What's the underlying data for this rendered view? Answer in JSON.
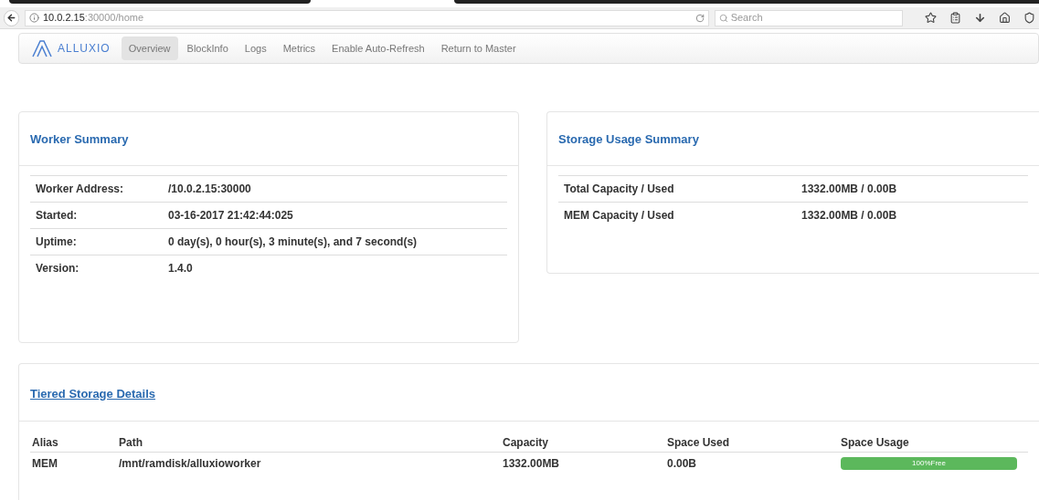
{
  "browser": {
    "url_host": "10.0.2.15",
    "url_rest": ":30000/home",
    "search_placeholder": "Search"
  },
  "navbar": {
    "brand": "ALLUXIO",
    "items": [
      {
        "label": "Overview",
        "selected": true
      },
      {
        "label": "BlockInfo",
        "selected": false
      },
      {
        "label": "Logs",
        "selected": false
      },
      {
        "label": "Metrics",
        "selected": false
      },
      {
        "label": "Enable Auto-Refresh",
        "selected": false
      },
      {
        "label": "Return to Master",
        "selected": false
      }
    ]
  },
  "worker_summary": {
    "title": "Worker Summary",
    "rows": [
      {
        "label": "Worker Address:",
        "value": "/10.0.2.15:30000"
      },
      {
        "label": "Started:",
        "value": "03-16-2017 21:42:44:025"
      },
      {
        "label": "Uptime:",
        "value": "0 day(s), 0 hour(s), 3 minute(s), and 7 second(s)"
      },
      {
        "label": "Version:",
        "value": "1.4.0"
      }
    ]
  },
  "storage_usage_summary": {
    "title": "Storage Usage Summary",
    "rows": [
      {
        "label": "Total Capacity / Used",
        "value": "1332.00MB / 0.00B"
      },
      {
        "label": "MEM Capacity / Used",
        "value": "1332.00MB / 0.00B"
      }
    ]
  },
  "tiered_storage": {
    "title": "Tiered Storage Details",
    "columns": [
      "Alias",
      "Path",
      "Capacity",
      "Space Used",
      "Space Usage"
    ],
    "rows": [
      {
        "alias": "MEM",
        "path": "/mnt/ramdisk/alluxioworker",
        "capacity": "1332.00MB",
        "space_used": "0.00B",
        "usage": {
          "level": 1,
          "text": "100%Free"
        }
      }
    ]
  }
}
